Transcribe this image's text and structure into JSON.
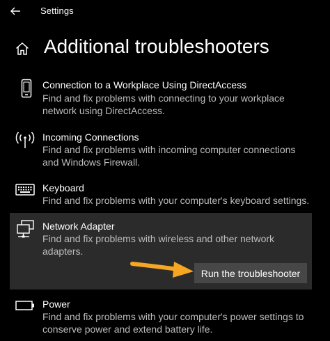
{
  "window": {
    "app_title": "Settings",
    "back_icon": "back-arrow-icon"
  },
  "header": {
    "home_icon": "home-icon",
    "title": "Additional troubleshooters"
  },
  "troubleshooters": [
    {
      "icon": "phone-icon",
      "title": "Connection to a Workplace Using DirectAccess",
      "description": "Find and fix problems with connecting to your workplace network using DirectAccess."
    },
    {
      "icon": "wireless-antenna-icon",
      "title": "Incoming Connections",
      "description": "Find and fix problems with incoming computer connections and Windows Firewall."
    },
    {
      "icon": "keyboard-icon",
      "title": "Keyboard",
      "description": "Find and fix problems with your computer's keyboard settings."
    },
    {
      "icon": "network-adapter-icon",
      "title": "Network Adapter",
      "description": "Find and fix problems with wireless and other network adapters.",
      "selected": true,
      "action_label": "Run the troubleshooter"
    },
    {
      "icon": "battery-icon",
      "title": "Power",
      "description": "Find and fix problems with your computer's power settings to conserve power and extend battery life."
    }
  ],
  "annotation": {
    "arrow_icon": "annotation-arrow-icon",
    "arrow_color": "#F5A623"
  },
  "colors": {
    "background": "#000000",
    "selected_item_bg": "#2B2B2B",
    "button_bg": "#474747",
    "secondary_text": "#BDBDBD"
  }
}
